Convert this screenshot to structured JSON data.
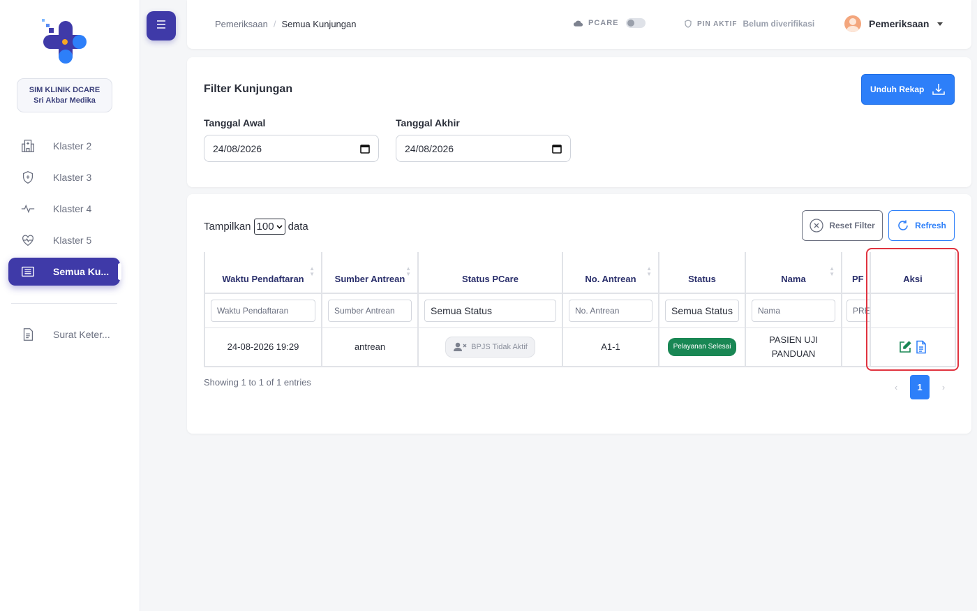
{
  "sidebar": {
    "clinic_line1": "SIM KLINIK DCARE",
    "clinic_line2": "Sri Akbar Medika",
    "items": [
      {
        "label": "Klaster 2",
        "icon": "hospital-icon"
      },
      {
        "label": "Klaster 3",
        "icon": "shield-plus-icon"
      },
      {
        "label": "Klaster 4",
        "icon": "pulse-icon"
      },
      {
        "label": "Klaster 5",
        "icon": "heart-pulse-icon"
      },
      {
        "label": "Semua Ku...",
        "icon": "list-icon",
        "active": true
      },
      {
        "label": "Surat Keter...",
        "icon": "document-icon"
      }
    ]
  },
  "header": {
    "breadcrumb": [
      "Pemeriksaan",
      "Semua Kunjungan"
    ],
    "pcare_label": "PCARE",
    "pin_label": "PIN AKTIF",
    "pin_value": "Belum diverifikasi",
    "user_name": "Pemeriksaan"
  },
  "filter": {
    "title": "Filter Kunjungan",
    "download_label": "Unduh Rekap",
    "start_label": "Tanggal Awal",
    "start_value": "24/08/2026",
    "end_label": "Tanggal Akhir",
    "end_value": "24/08/2026"
  },
  "table": {
    "show_prefix": "Tampilkan",
    "show_value": "100",
    "show_suffix": "data",
    "reset_label": "Reset Filter",
    "refresh_label": "Refresh",
    "columns": [
      "Waktu Pendaftaran",
      "Sumber Antrean",
      "Status PCare",
      "No. Antrean",
      "Status",
      "Nama",
      "PF",
      "Aksi"
    ],
    "filters": [
      "Waktu Pendaftaran",
      "Sumber Antrean",
      "Semua Status",
      "No. Antrean",
      "Semua Status",
      "Nama",
      "PRE"
    ],
    "rows": [
      {
        "waktu": "24-08-2026 19:29",
        "sumber": "antrean",
        "status_pcare": "BPJS Tidak Aktif",
        "no_antrean": "A1-1",
        "status": "Pelayanan Selesai",
        "nama": "PASIEN UJI PANDUAN",
        "pf": ""
      }
    ],
    "showing": "Showing 1 to 1 of 1 entries",
    "pagination": {
      "prev": "‹",
      "current": "1",
      "next": "›"
    }
  },
  "colors": {
    "primary": "#3f3aa8",
    "accent": "#2d7ff9",
    "success": "#198754",
    "highlight": "#e0333f"
  }
}
